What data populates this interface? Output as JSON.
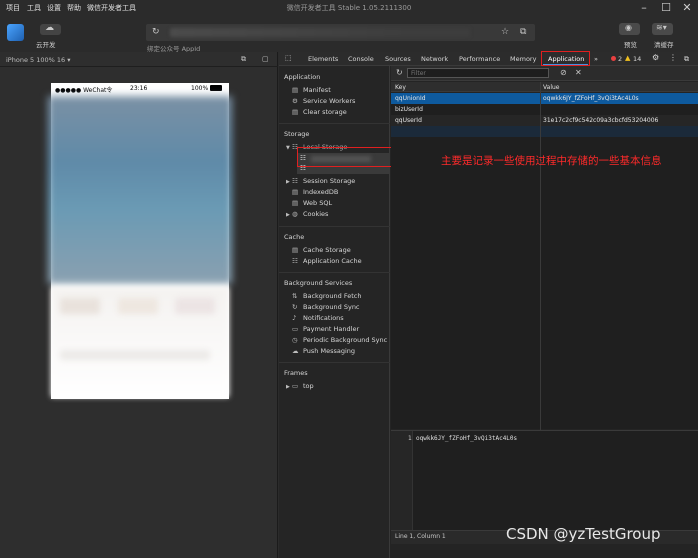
{
  "menu": {
    "items": [
      "项目",
      "工具",
      "设置",
      "帮助",
      "微信开发者工具"
    ]
  },
  "window": {
    "title": "微信开发者工具 Stable 1.05.2111300"
  },
  "toolbar": {
    "cloud_label": "云开发",
    "bind_label": "绑定公众号 AppId",
    "preview_label": "预览",
    "clear_label": "清缓存"
  },
  "simulator": {
    "device_label": "iPhone 5 100% 16 ▾",
    "status_carrier": "●●●●● WeChat令",
    "status_time": "23:16",
    "status_battery": "100%"
  },
  "devtools": {
    "tabs": [
      "Elements",
      "Console",
      "Sources",
      "Network",
      "Performance",
      "Memory",
      "Application"
    ],
    "more_tabs": "»",
    "error_count": "2",
    "warning_count": "14"
  },
  "sidebar": {
    "application_head": "Application",
    "application_items": [
      "Manifest",
      "Service Workers",
      "Clear storage"
    ],
    "storage_head": "Storage",
    "local_storage": "Local Storage",
    "storage_items": [
      "Session Storage",
      "IndexedDB",
      "Web SQL",
      "Cookies"
    ],
    "cache_head": "Cache",
    "cache_items": [
      "Cache Storage",
      "Application Cache"
    ],
    "bg_head": "Background Services",
    "bg_items": [
      "Background Fetch",
      "Background Sync",
      "Notifications",
      "Payment Handler",
      "Periodic Background Sync",
      "Push Messaging"
    ],
    "frames_head": "Frames",
    "frames_items": [
      "top"
    ]
  },
  "storage_table": {
    "filter_placeholder": "Filter",
    "col_key": "Key",
    "col_value": "Value",
    "rows": [
      {
        "key": "qqUnionId",
        "value": "oqwkk6JY_fZFoHf_3vQi3tAc4L0s"
      },
      {
        "key": "bizUserId",
        "value": ""
      },
      {
        "key": "qqUserId",
        "value": "31e17c2cf9c542c09a3cbcfd53204006"
      }
    ]
  },
  "annotation": "主要是记录一些使用过程中存储的一些基本信息",
  "preview": {
    "line_no": "1",
    "text": "oqwkk6JY_fZFoHf_3vQi3tAc4L0s",
    "cursor": "Line 1, Column 1"
  },
  "watermark": "CSDN @yzTestGroup",
  "colors": {
    "accent_red": "#e02020",
    "selected_row": "#0e5a9e",
    "annotation": "#ff2a2a"
  }
}
